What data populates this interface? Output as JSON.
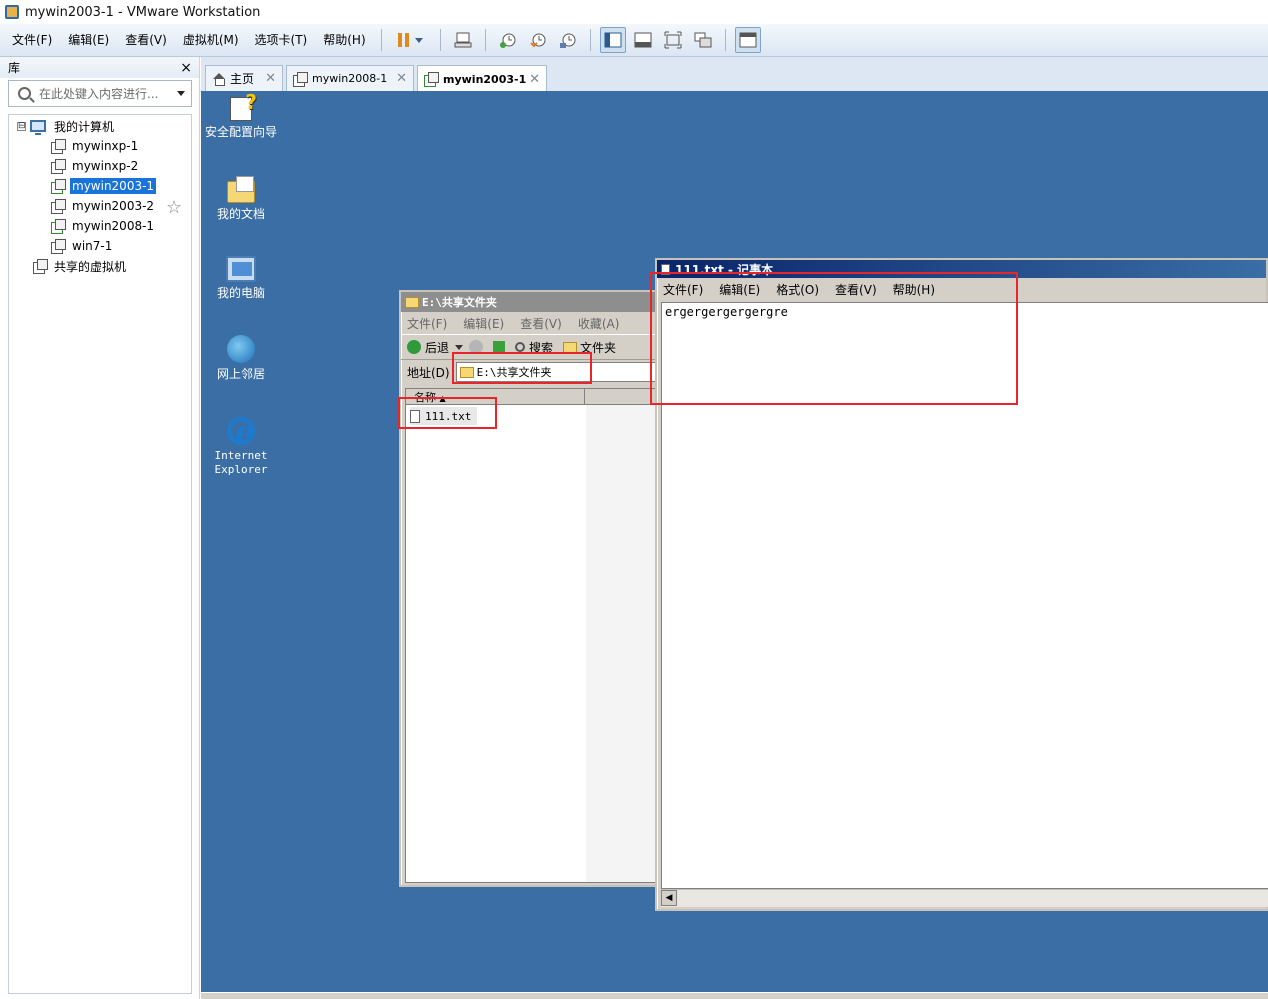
{
  "window": {
    "title": "mywin2003-1 - VMware Workstation"
  },
  "menubar": {
    "items": [
      "文件(F)",
      "编辑(E)",
      "查看(V)",
      "虚拟机(M)",
      "选项卡(T)",
      "帮助(H)"
    ]
  },
  "toolbar": {
    "icons": [
      "pause-icon",
      "send-ctrl-alt-del-icon",
      "snapshot-take-icon",
      "snapshot-revert-icon",
      "snapshot-manager-icon",
      "show-library-icon",
      "thumbnail-bar-icon",
      "full-screen-icon",
      "unity-icon",
      "console-view-icon"
    ]
  },
  "library": {
    "title": "库",
    "close_label": "×",
    "search_placeholder": "在此处键入内容进行...",
    "tree": {
      "root_expander": "⊟",
      "root_label": "我的计算机",
      "vms": [
        "mywinxp-1",
        "mywinxp-2",
        "mywin2003-1",
        "mywin2003-2",
        "mywin2008-1",
        "win7-1"
      ],
      "selected": "mywin2003-1",
      "shared_label": "共享的虚拟机"
    }
  },
  "tabs": [
    {
      "label": "主页",
      "close": "✕"
    },
    {
      "label": "mywin2008-1",
      "close": "✕"
    },
    {
      "label": "mywin2003-1",
      "close": "✕",
      "active": true
    }
  ],
  "desktop": {
    "icons": [
      {
        "label": "安全配置向导",
        "icon": "security-wizard-icon"
      },
      {
        "label": "我的文档",
        "icon": "my-documents-icon"
      },
      {
        "label": "我的电脑",
        "icon": "my-computer-icon"
      },
      {
        "label": "网上邻居",
        "icon": "network-places-icon"
      },
      {
        "label1": "Internet",
        "label2": "Explorer",
        "icon": "internet-explorer-icon"
      }
    ]
  },
  "explorer": {
    "title": "E:\\共享文件夹",
    "menu": [
      "文件(F)",
      "编辑(E)",
      "查看(V)",
      "收藏(A)"
    ],
    "toolbar": {
      "back": "后退",
      "search": "搜索",
      "folders": "文件夹"
    },
    "address_label": "地址(D)",
    "address_value": "E:\\共享文件夹",
    "column_name": "名称",
    "files": [
      "111.txt"
    ]
  },
  "notepad": {
    "title": "111.txt - 记事本",
    "menu": [
      "文件(F)",
      "编辑(E)",
      "格式(O)",
      "查看(V)",
      "帮助(H)"
    ],
    "content": "ergergergergergre"
  },
  "colors": {
    "desktop": "#3a6ea5",
    "highlight": "#e8262a",
    "selection": "#1a73d9"
  }
}
